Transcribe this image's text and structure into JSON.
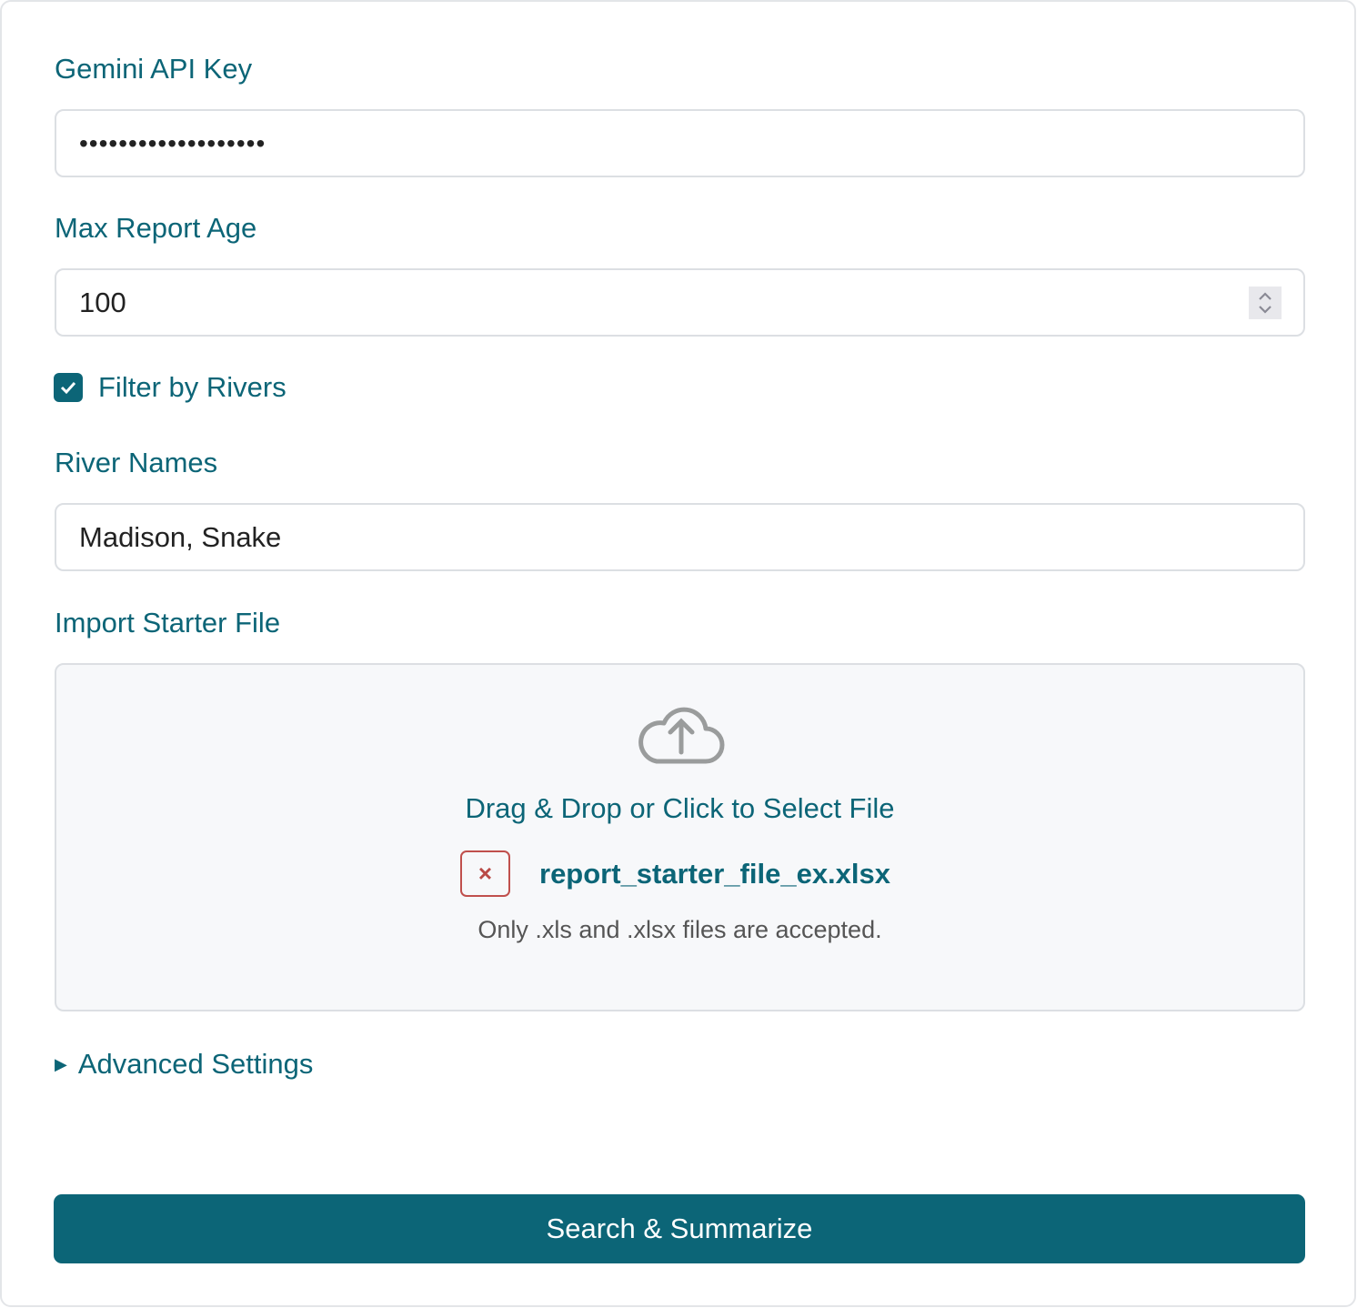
{
  "api_key": {
    "label": "Gemini API Key",
    "value": "•••••••••••••••••••"
  },
  "max_age": {
    "label": "Max Report Age",
    "value": "100"
  },
  "filter": {
    "label": "Filter by Rivers",
    "checked": true
  },
  "rivers": {
    "label": "River Names",
    "value": "Madison, Snake"
  },
  "import": {
    "label": "Import Starter File",
    "drop_text": "Drag & Drop or Click to Select File",
    "file_name": "report_starter_file_ex.xlsx",
    "remove_icon": "×",
    "hint": "Only .xls and .xlsx files are accepted."
  },
  "advanced": {
    "label": "Advanced Settings",
    "icon": "▶"
  },
  "submit_label": "Search & Summarize",
  "colors": {
    "accent": "#0c6577",
    "danger": "#c0504d"
  }
}
